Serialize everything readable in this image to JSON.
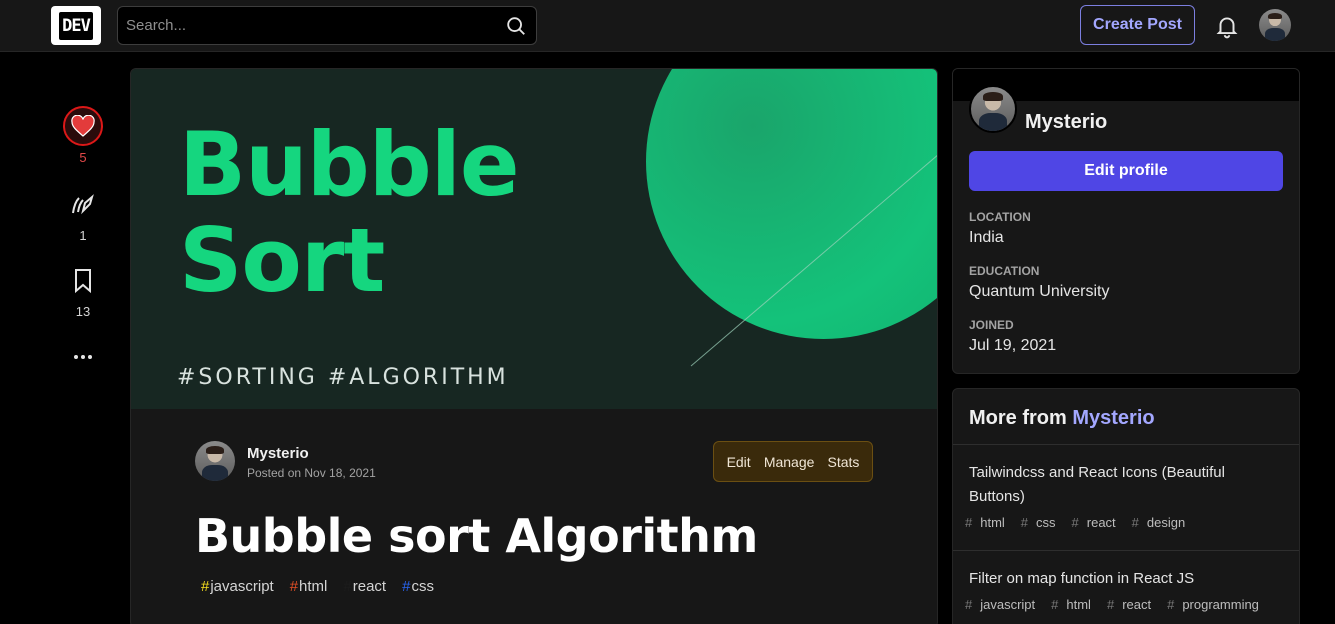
{
  "header": {
    "logo_text": "DEV",
    "search_placeholder": "Search...",
    "create_post_label": "Create Post"
  },
  "reactions": {
    "likes": "5",
    "unicorns": "1",
    "bookmarks": "13"
  },
  "article": {
    "cover": {
      "title_line1": "Bubble",
      "title_line2": "Sort",
      "tags": "#SORTING #ALGORITHM"
    },
    "author_name": "Mysterio",
    "posted_on": "Posted on Nov 18, 2021",
    "actions": [
      "Edit",
      "Manage",
      "Stats"
    ],
    "title": "Bubble sort Algorithm",
    "tags": [
      {
        "name": "javascript",
        "color": "#f7df1e"
      },
      {
        "name": "html",
        "color": "#e34f26"
      },
      {
        "name": "react",
        "color": "#1c1c1c"
      },
      {
        "name": "css",
        "color": "#2965f1"
      }
    ]
  },
  "profile": {
    "name": "Mysterio",
    "edit_label": "Edit profile",
    "location_label": "LOCATION",
    "location": "India",
    "education_label": "EDUCATION",
    "education": "Quantum University",
    "joined_label": "JOINED",
    "joined": "Jul 19, 2021"
  },
  "more_from": {
    "prefix": "More from",
    "author": "Mysterio",
    "items": [
      {
        "title": "Tailwindcss and React Icons (Beautiful Buttons)",
        "tags": [
          "html",
          "css",
          "react",
          "design"
        ]
      },
      {
        "title": "Filter on map function in React JS",
        "tags": [
          "javascript",
          "html",
          "react",
          "programming"
        ]
      }
    ]
  },
  "colors": {
    "accent": "#4f46e5",
    "like_red": "#dc1818",
    "cover_green": "#15d67f"
  }
}
